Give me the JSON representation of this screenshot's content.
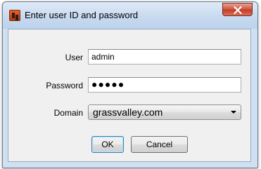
{
  "window": {
    "title": "Enter user ID and password",
    "app_icon": "grass-valley-app-icon",
    "close_icon": "close-icon"
  },
  "form": {
    "user_label": "User",
    "user_value": "admin",
    "password_label": "Password",
    "password_value": "●●●●●",
    "domain_label": "Domain",
    "domain_value": "grassvalley.com"
  },
  "buttons": {
    "ok_label": "OK",
    "cancel_label": "Cancel"
  },
  "colors": {
    "title_bar": "#c6d9ef",
    "close_button": "#c23e27",
    "client_background": "#f0f0f0"
  }
}
